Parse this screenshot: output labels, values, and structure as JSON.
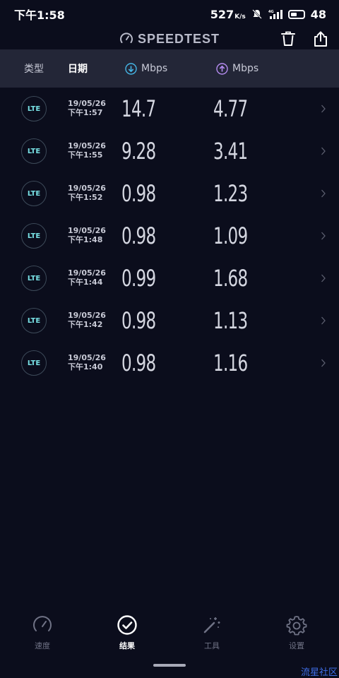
{
  "status_bar": {
    "time": "下午1:58",
    "net_speed": "527",
    "net_speed_unit": "K/s",
    "battery": "48",
    "battery_fraction": 0.48
  },
  "app": {
    "title": "SPEEDTEST"
  },
  "columns": {
    "type": "类型",
    "date": "日期",
    "download_unit": "Mbps",
    "upload_unit": "Mbps"
  },
  "colors": {
    "download_accent": "#45b6e6",
    "upload_accent": "#b58cf0",
    "lte_text": "#78e0e4"
  },
  "results": [
    {
      "type": "LTE",
      "date": "19/05/26",
      "time": "下午1:57",
      "download": "14.7",
      "upload": "4.77"
    },
    {
      "type": "LTE",
      "date": "19/05/26",
      "time": "下午1:55",
      "download": "9.28",
      "upload": "3.41"
    },
    {
      "type": "LTE",
      "date": "19/05/26",
      "time": "下午1:52",
      "download": "0.98",
      "upload": "1.23"
    },
    {
      "type": "LTE",
      "date": "19/05/26",
      "time": "下午1:48",
      "download": "0.98",
      "upload": "1.09"
    },
    {
      "type": "LTE",
      "date": "19/05/26",
      "time": "下午1:44",
      "download": "0.99",
      "upload": "1.68"
    },
    {
      "type": "LTE",
      "date": "19/05/26",
      "time": "下午1:42",
      "download": "0.98",
      "upload": "1.13"
    },
    {
      "type": "LTE",
      "date": "19/05/26",
      "time": "下午1:40",
      "download": "0.98",
      "upload": "1.16"
    }
  ],
  "nav": [
    {
      "label": "速度",
      "icon": "speedometer-icon",
      "active": false
    },
    {
      "label": "结果",
      "icon": "checkmark-circle-icon",
      "active": true
    },
    {
      "label": "工具",
      "icon": "magic-wand-icon",
      "active": false
    },
    {
      "label": "设置",
      "icon": "gear-icon",
      "active": false
    }
  ],
  "watermark": "流星社区"
}
